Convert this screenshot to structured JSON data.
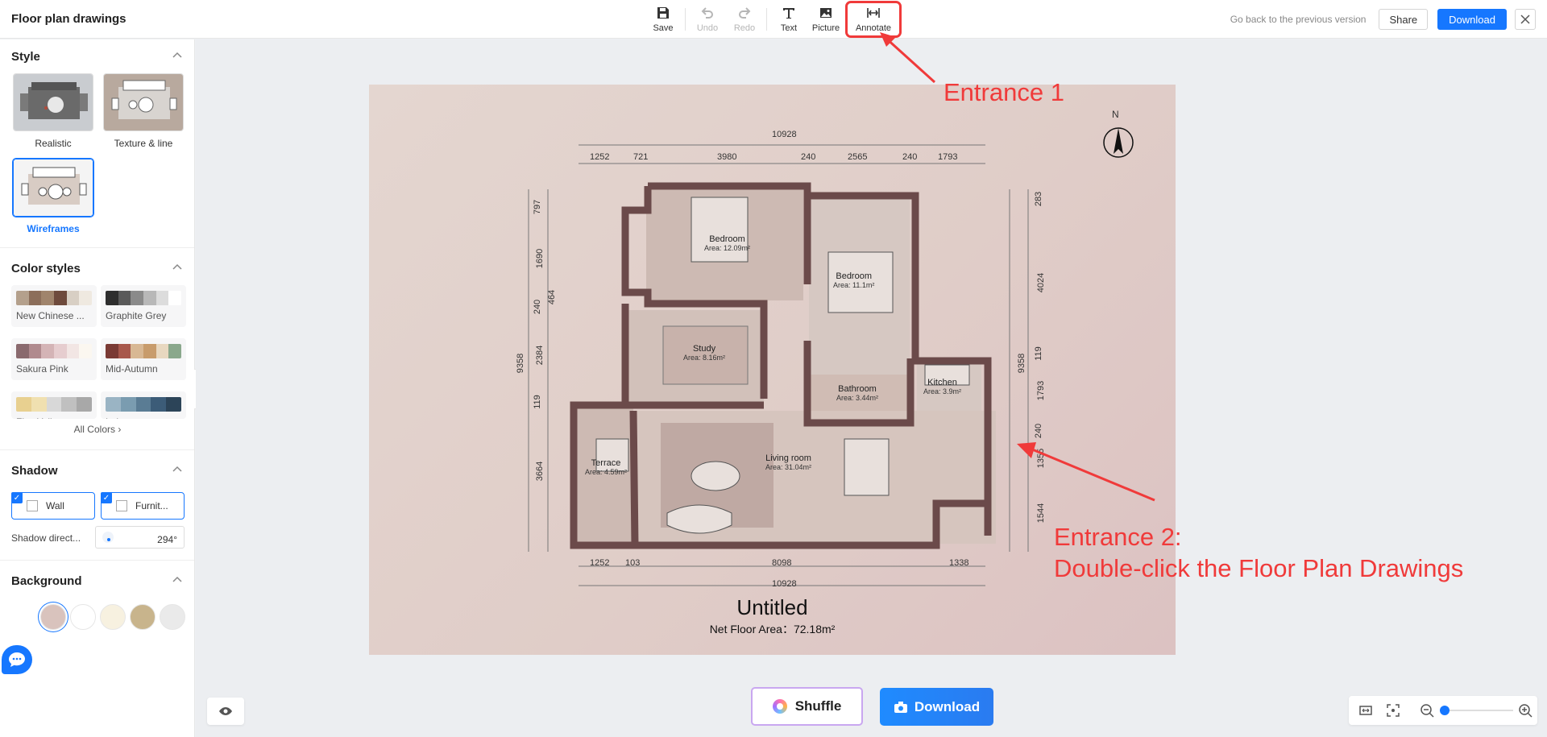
{
  "app": {
    "title": "Floor plan drawings"
  },
  "toolbar": [
    {
      "id": "save",
      "label": "Save",
      "icon": "save-icon",
      "enabled": true
    },
    {
      "id": "undo",
      "label": "Undo",
      "icon": "undo-icon",
      "enabled": false
    },
    {
      "id": "redo",
      "label": "Redo",
      "icon": "redo-icon",
      "enabled": false
    },
    {
      "id": "text",
      "label": "Text",
      "icon": "text-icon",
      "enabled": true
    },
    {
      "id": "picture",
      "label": "Picture",
      "icon": "picture-icon",
      "enabled": true
    },
    {
      "id": "annotate",
      "label": "Annotate",
      "icon": "annotate-icon",
      "enabled": true
    }
  ],
  "header_right": {
    "prev_version": "Go back to the previous version",
    "share": "Share",
    "download": "Download",
    "close_icon": "close-icon"
  },
  "sidebar": {
    "style": {
      "title": "Style",
      "options": [
        {
          "label": "Realistic",
          "selected": false
        },
        {
          "label": "Texture & line",
          "selected": false
        },
        {
          "label": "Wireframes",
          "selected": true
        }
      ]
    },
    "color_styles": {
      "title": "Color styles",
      "palettes": [
        {
          "name": "New Chinese ...",
          "colors": [
            "#b4a08c",
            "#8c6e5a",
            "#a0846c",
            "#6e4a3c",
            "#d8cfc4",
            "#efe9e0"
          ]
        },
        {
          "name": "Graphite Grey",
          "colors": [
            "#2e2e2e",
            "#5a5a5a",
            "#8a8a8a",
            "#b8b8b8",
            "#dcdcdc",
            "#ffffff"
          ]
        },
        {
          "name": "Sakura Pink",
          "colors": [
            "#8a6a6e",
            "#b08a8e",
            "#d4b4b6",
            "#e6cdcf",
            "#f2e6e4",
            "#fbf7f0"
          ]
        },
        {
          "name": "Mid-Autumn",
          "colors": [
            "#7a3a34",
            "#a8584c",
            "#d8b894",
            "#c89c6c",
            "#e8d8c0",
            "#8aa88c"
          ]
        },
        {
          "name": "Flax Yellow",
          "colors": [
            "#e8d090",
            "#f0e0b0",
            "#d8d8d8",
            "#c0c0c0",
            "#a8a8a8"
          ]
        },
        {
          "name": "Lake green",
          "colors": [
            "#9ab4c4",
            "#7a9cb0",
            "#5a7c94",
            "#3c5c78",
            "#2c4458"
          ]
        }
      ],
      "all_colors": "All Colors"
    },
    "shadow": {
      "title": "Shadow",
      "options": [
        {
          "label": "Wall",
          "checked": true
        },
        {
          "label": "Furnit...",
          "checked": true
        }
      ],
      "direction_label": "Shadow direct...",
      "direction_value": "294°"
    },
    "background": {
      "title": "Background",
      "swatches": [
        "#d9c3bd",
        "#ffffff",
        "#f7f1e0",
        "#c8b48c",
        "#eaeaea"
      ],
      "selected_index": 0
    }
  },
  "plan": {
    "title": "Untitled",
    "net_area": "Net Floor Area：72.18m²",
    "north": "N",
    "dims_top_total": "10928",
    "dims_top": [
      "1252",
      "721",
      "3980",
      "240",
      "2565",
      "240",
      "1793"
    ],
    "dims_bottom": [
      "1252",
      "103",
      "8098",
      "1338"
    ],
    "dims_bottom_total": "10928",
    "dims_left": [
      "797",
      "1690",
      "240",
      "464",
      "2384",
      "119",
      "3664"
    ],
    "dims_left_total": "9358",
    "dims_right": [
      "283",
      "4024",
      "119",
      "1793",
      "240",
      "1355",
      "1544"
    ],
    "dims_right_total": "9358",
    "rooms": [
      {
        "name": "Bedroom",
        "area": "Area: 12.09m²"
      },
      {
        "name": "Bedroom",
        "area": "Area: 11.1m²"
      },
      {
        "name": "Study",
        "area": "Area: 8.16m²"
      },
      {
        "name": "Bathroom",
        "area": "Area: 3.44m²"
      },
      {
        "name": "Kitchen",
        "area": "Area: 3.9m²"
      },
      {
        "name": "Terrace",
        "area": "Area: 4.59m²"
      },
      {
        "name": "Living room",
        "area": "Area: 31.04m²"
      }
    ]
  },
  "annotations": {
    "entrance1": "Entrance 1",
    "entrance2_line1": "Entrance 2:",
    "entrance2_line2": "Double-click the Floor Plan Drawings",
    "color": "#f03a3a"
  },
  "bottom": {
    "shuffle": "Shuffle",
    "download": "Download",
    "zoom_level": 0.05
  },
  "colors": {
    "accent": "#1677ff",
    "wall": "#6b4a4a",
    "room_floor": "#cbb7b0"
  }
}
